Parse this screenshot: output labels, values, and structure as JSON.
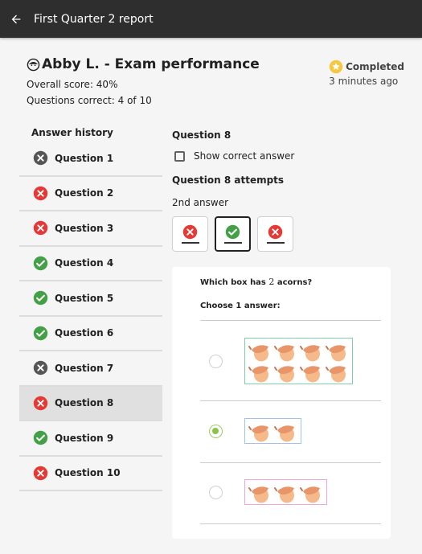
{
  "appbar": {
    "title": "First Quarter 2 report"
  },
  "learner": {
    "title": "Abby L. - Exam performance",
    "overall_score": "Overall score: 40%",
    "questions_correct": "Questions correct: 4 of 10"
  },
  "status": {
    "label": "Completed",
    "time": "3 minutes ago"
  },
  "history": {
    "title": "Answer history",
    "items": [
      {
        "label": "Question 1",
        "status": "unanswered"
      },
      {
        "label": "Question 2",
        "status": "incorrect"
      },
      {
        "label": "Question 3",
        "status": "incorrect"
      },
      {
        "label": "Question 4",
        "status": "correct"
      },
      {
        "label": "Question 5",
        "status": "correct"
      },
      {
        "label": "Question 6",
        "status": "correct"
      },
      {
        "label": "Question 7",
        "status": "unanswered"
      },
      {
        "label": "Question 8",
        "status": "incorrect",
        "active": true
      },
      {
        "label": "Question 9",
        "status": "correct"
      },
      {
        "label": "Question 10",
        "status": "incorrect"
      }
    ]
  },
  "detail": {
    "question_title": "Question 8",
    "show_correct_label": "Show correct answer",
    "attempts_title": "Question 8 attempts",
    "attempt_label": "2nd answer",
    "attempts": [
      "incorrect",
      "correct",
      "incorrect"
    ]
  },
  "card": {
    "prompt_pre": "Which box has ",
    "prompt_num": "2",
    "prompt_post": " acorns?",
    "choose_label": "Choose 1 answer:",
    "options": [
      {
        "acorns": 8,
        "border": "#7fcfa8",
        "selected": false
      },
      {
        "acorns": 2,
        "border": "#9fc3ea",
        "selected": true
      },
      {
        "acorns": 3,
        "border": "#f0a6d8",
        "selected": false
      }
    ]
  },
  "colors": {
    "appbar": "#2e2e2e",
    "incorrect": "#e53935",
    "correct": "#43a047",
    "unanswered": "#555555",
    "star": "#f5c842"
  }
}
